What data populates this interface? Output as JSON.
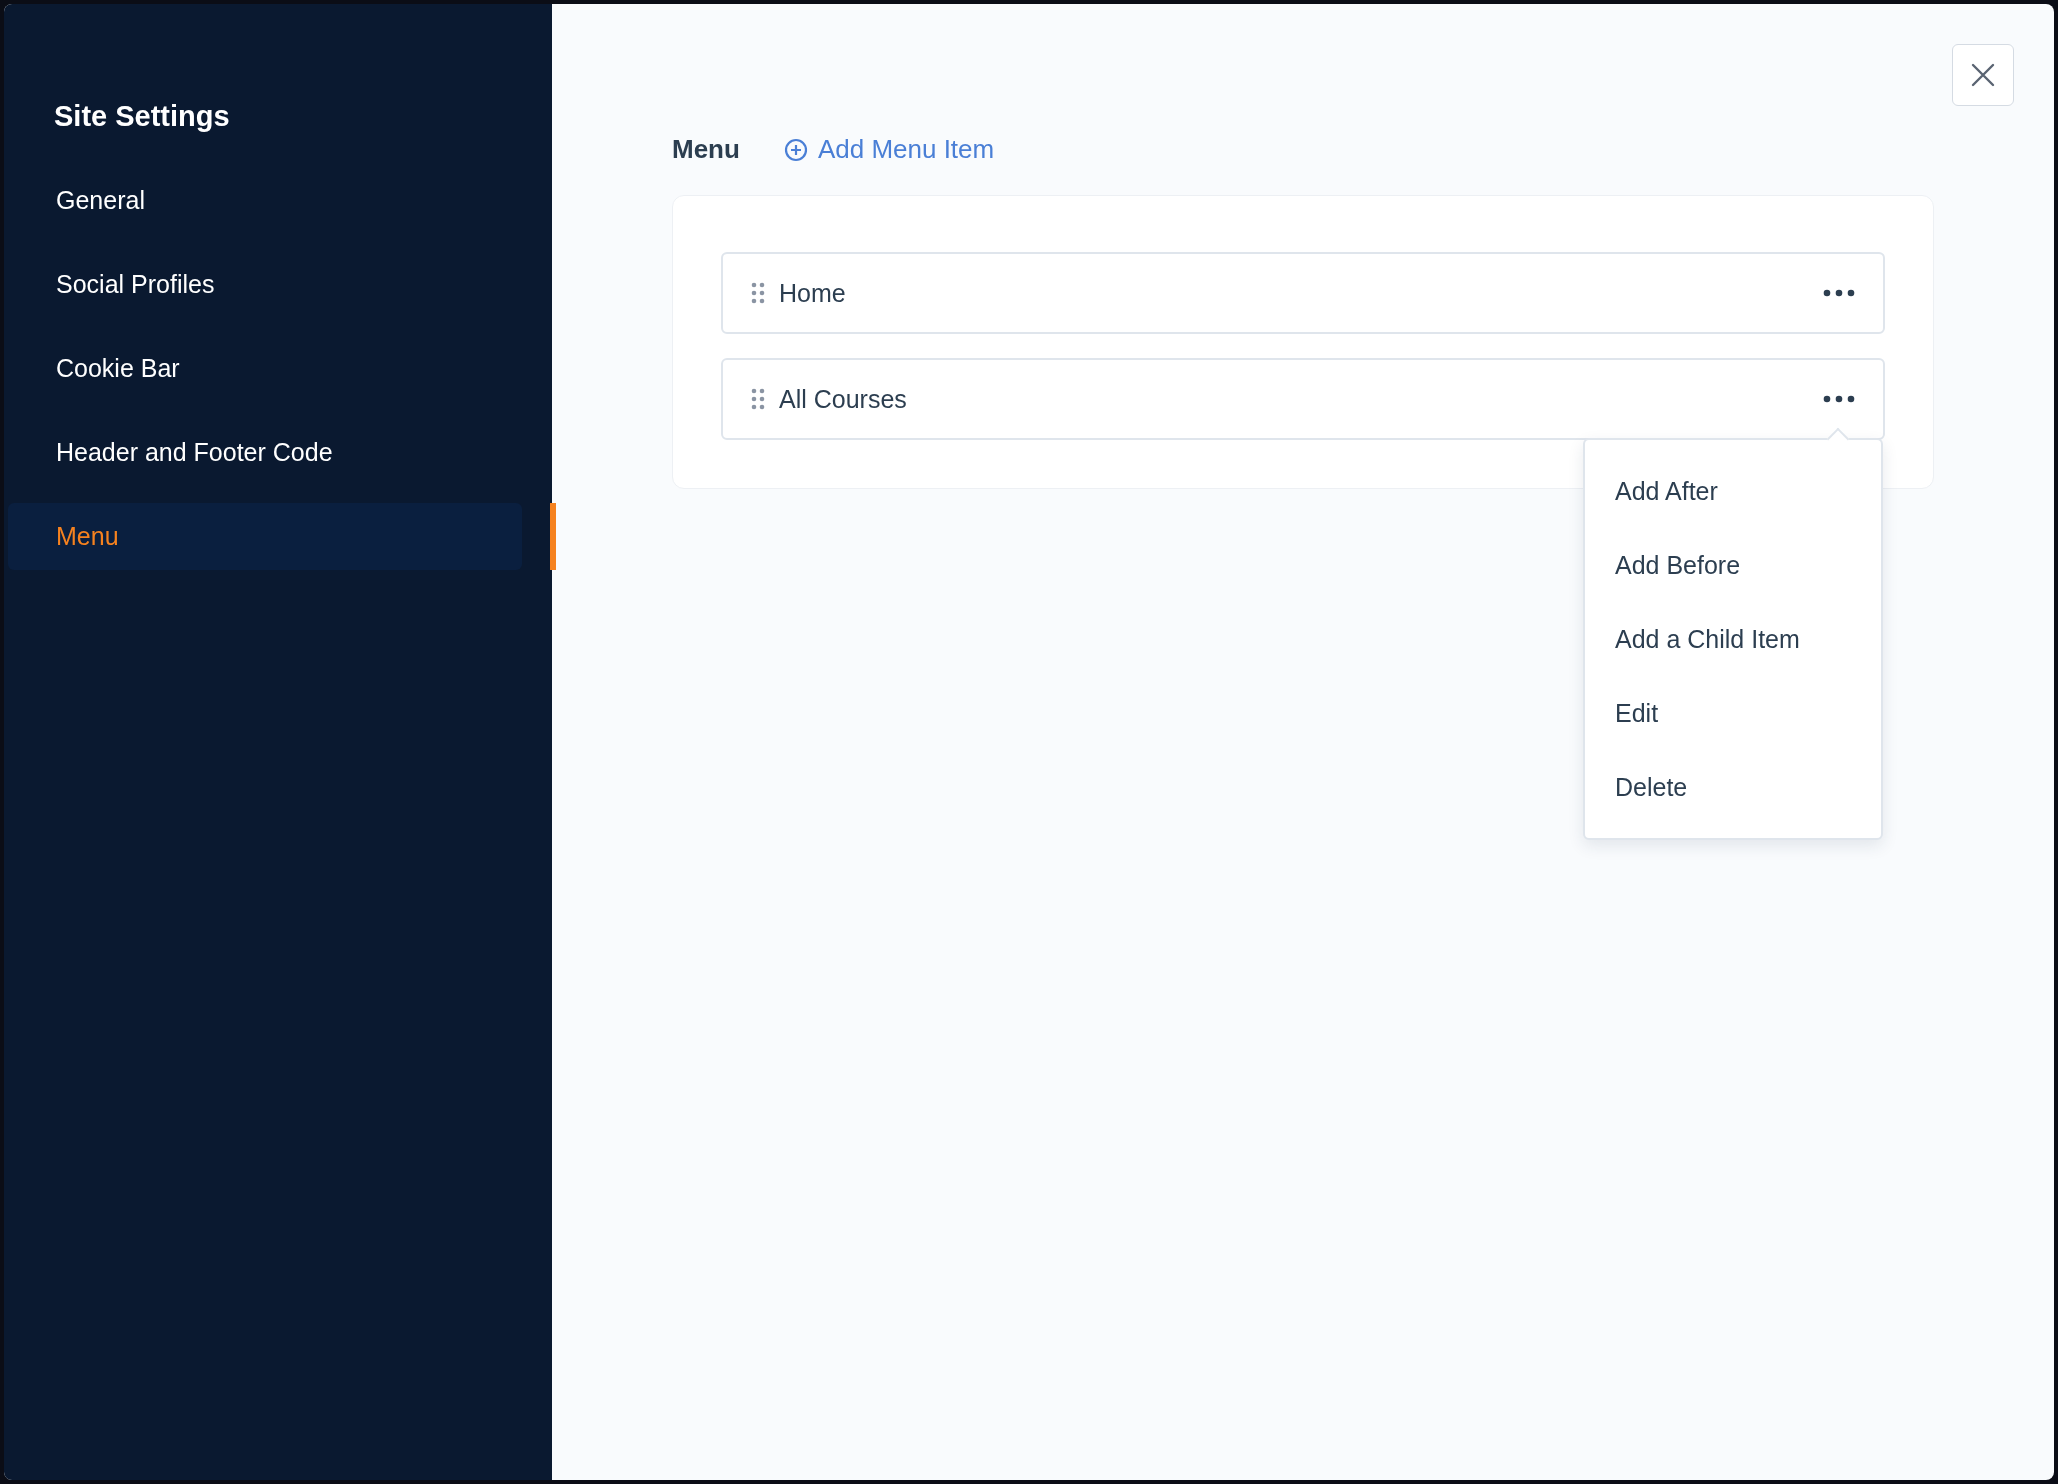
{
  "sidebar": {
    "title": "Site Settings",
    "items": [
      {
        "label": "General",
        "selected": false
      },
      {
        "label": "Social Profiles",
        "selected": false
      },
      {
        "label": "Cookie Bar",
        "selected": false
      },
      {
        "label": "Header and Footer Code",
        "selected": false
      },
      {
        "label": "Menu",
        "selected": true
      }
    ]
  },
  "main": {
    "heading": "Menu",
    "add_button": "Add Menu Item",
    "menu_items": [
      {
        "label": "Home",
        "menu_open": false
      },
      {
        "label": "All Courses",
        "menu_open": true
      }
    ],
    "context_menu": {
      "items": [
        "Add After",
        "Add Before",
        "Add a Child Item",
        "Edit",
        "Delete"
      ]
    }
  }
}
